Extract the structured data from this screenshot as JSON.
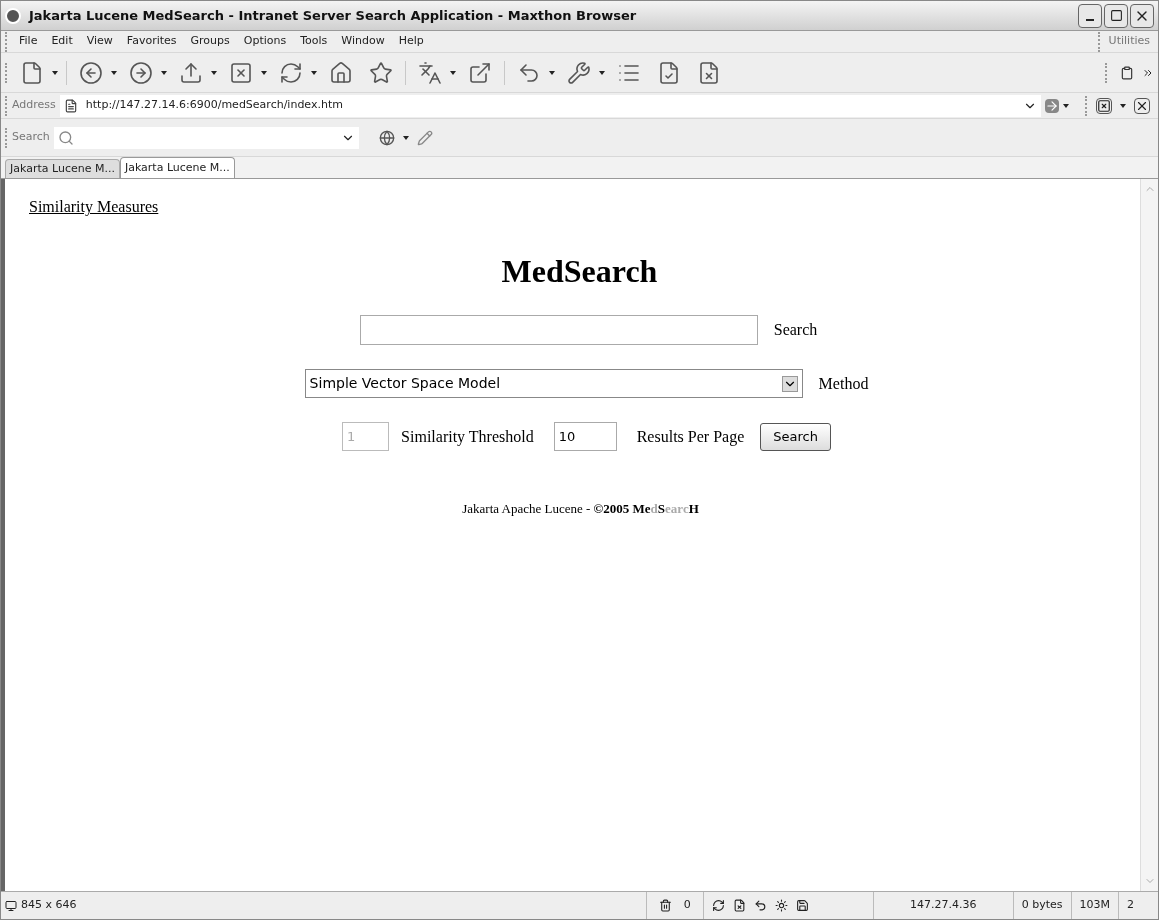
{
  "window": {
    "title": "Jakarta Lucene MedSearch - Intranet Server Search Application - Maxthon Browser"
  },
  "menu": {
    "items": [
      "File",
      "Edit",
      "View",
      "Favorites",
      "Groups",
      "Options",
      "Tools",
      "Window",
      "Help"
    ],
    "utilities": "Utilities"
  },
  "address_bar": {
    "label": "Address",
    "value": "http://147.27.14.6:6900/medSearch/index.htm"
  },
  "search_bar": {
    "label": "Search"
  },
  "tabs": [
    {
      "label": "Jakarta Lucene M...",
      "selected": false
    },
    {
      "label": "Jakarta Lucene M...",
      "selected": true
    }
  ],
  "page": {
    "link": "Similarity Measures",
    "heading": "MedSearch",
    "query": {
      "label": "Search"
    },
    "method": {
      "value": "Simple Vector Space Model",
      "label": "Method"
    },
    "threshold": {
      "value": "1",
      "disabled": true,
      "label": "Similarity Threshold"
    },
    "results_per_page": {
      "value": "10",
      "label": "Results Per Page"
    },
    "button": "Search",
    "footer": [
      {
        "text": "Jakarta Apache Lucene - ",
        "bold": false,
        "faint": false
      },
      {
        "text": "©2005 Me",
        "bold": true,
        "faint": false
      },
      {
        "text": "d",
        "bold": true,
        "faint": true
      },
      {
        "text": "S",
        "bold": true,
        "faint": false
      },
      {
        "text": "earc",
        "bold": true,
        "faint": true
      },
      {
        "text": "H",
        "bold": true,
        "faint": false
      }
    ]
  },
  "status_bar": {
    "dimensions": "845 x 646",
    "popups_blocked": "0",
    "ip": "147.27.4.36",
    "bytes": "0 bytes",
    "memory": "103M",
    "count": "2"
  }
}
